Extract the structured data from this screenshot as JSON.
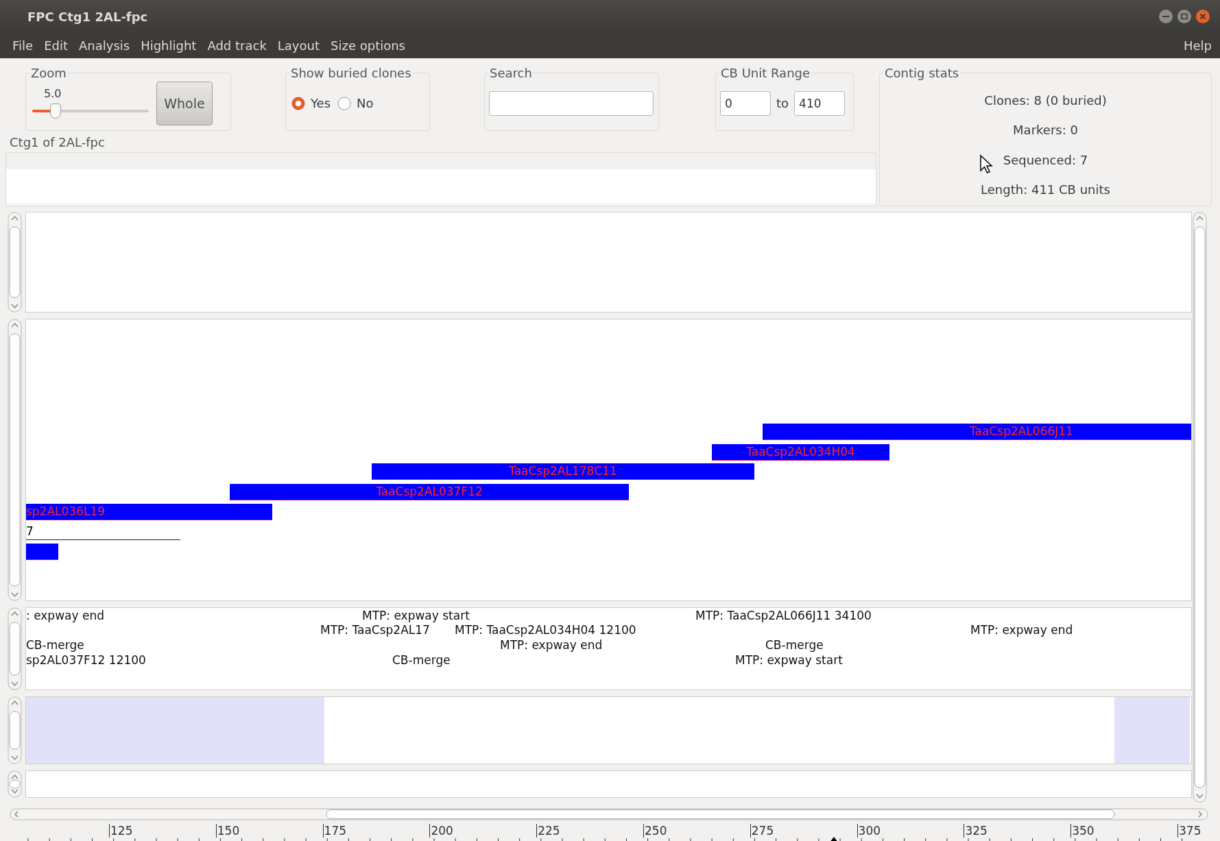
{
  "window": {
    "title": "FPC Ctg1 2AL-fpc"
  },
  "menu": [
    {
      "label": "File"
    },
    {
      "label": "Edit"
    },
    {
      "label": "Analysis"
    },
    {
      "label": "Highlight"
    },
    {
      "label": "Add track"
    },
    {
      "label": "Layout"
    },
    {
      "label": "Size options"
    }
  ],
  "help_menu": {
    "label": "Help"
  },
  "zoom": {
    "label": "Zoom",
    "reading": "5.0",
    "level": 0.2,
    "button": "Whole"
  },
  "buried_clones": {
    "label": "Show buried clones",
    "options": [
      {
        "label": "Yes",
        "selected": true
      },
      {
        "label": "No",
        "selected": false
      }
    ]
  },
  "search": {
    "label": "Search"
  },
  "cb_unit_range": {
    "label": "CB Unit Range",
    "from": "0",
    "separator": "to",
    "to": "410"
  },
  "contig_label": "Ctg1 of 2AL-fpc",
  "contig_stats": {
    "label": "Contig stats",
    "lines": [
      "Clones: 8 (0 buried)",
      "Markers: 0",
      "Sequenced: 7",
      "Length: 411 CB units"
    ]
  },
  "clones": [
    {
      "name": "TaaCsp2AL066J11"
    },
    {
      "name": "TaaCsp2AL034H04"
    },
    {
      "name": "TaaCsp2AL178C11"
    },
    {
      "name": "TaaCsp2AL037F12"
    },
    {
      "name": "sp2AL036L19"
    }
  ],
  "sequence_track": {
    "label": "7"
  },
  "markers": [
    {
      "text": ": expway end"
    },
    {
      "text": "MTP: expway start"
    },
    {
      "text": "MTP: TaaCsp2AL066J11 34100"
    },
    {
      "text": "MTP: TaaCsp2AL17"
    },
    {
      "text": "MTP: TaaCsp2AL034H04 12100"
    },
    {
      "text": "MTP: expway end"
    },
    {
      "text": "CB-merge"
    },
    {
      "text": "MTP: expway end"
    },
    {
      "text": "CB-merge"
    },
    {
      "text": "sp2AL037F12 12100"
    },
    {
      "text": "CB-merge"
    },
    {
      "text": "MTP: expway start"
    }
  ],
  "ruler": {
    "ticks": [
      "125",
      "150",
      "175",
      "200",
      "225",
      "250",
      "275",
      "300",
      "325",
      "350",
      "375"
    ]
  }
}
